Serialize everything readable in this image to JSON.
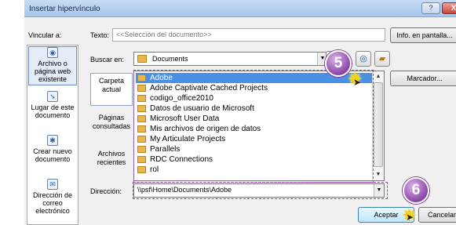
{
  "dialog": {
    "title": "Insertar hipervínculo",
    "help_label": "?",
    "close_label": "X"
  },
  "link_to": {
    "label": "Vincular a:",
    "items": [
      {
        "label": "Archivo o página web existente"
      },
      {
        "label": "Lugar de este documento"
      },
      {
        "label": "Crear nuevo documento"
      },
      {
        "label": "Dirección de correo electrónico"
      }
    ]
  },
  "text_display": {
    "label": "Texto:",
    "value": "<<Selección del documento>>"
  },
  "screentip_button": "Info. en pantalla...",
  "look_in": {
    "label": "Buscar en:",
    "value": "Documents"
  },
  "sub_panel": {
    "items": [
      {
        "label": "Carpeta actual"
      },
      {
        "label": "Páginas consultadas"
      },
      {
        "label": "Archivos recientes"
      }
    ]
  },
  "file_list": {
    "items": [
      "Adobe",
      "Adobe Captivate Cached Projects",
      "codigo_office2010",
      "Datos de usuario de Microsoft",
      "Microsoft User Data",
      "Mis archivos de origen de datos",
      "My Articulate Projects",
      "Parallels",
      "RDC Connections",
      "rol"
    ],
    "selected_index": 0
  },
  "bookmark_button": "Marcador...",
  "address": {
    "label": "Dirección:",
    "value": "\\\\psf\\Home\\Documents\\Adobe"
  },
  "buttons": {
    "ok": "Aceptar",
    "cancel": "Cancelar"
  },
  "callouts": {
    "step5": "5",
    "step6": "6"
  },
  "colors": {
    "selection": "#4a90e3",
    "callout": "#8c44a8",
    "highlight_star": "#f4d21c"
  }
}
